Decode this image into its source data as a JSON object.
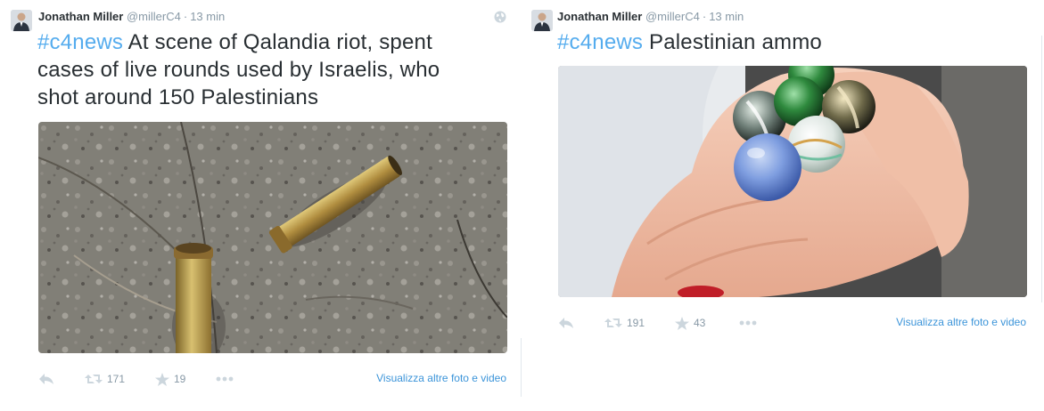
{
  "tweets": [
    {
      "author": {
        "name": "Jonathan Miller",
        "handle": "@millerC4"
      },
      "time": "13 min",
      "hashtag": "#c4news",
      "text_lines": [
        " At scene of Qalandia riot, spent",
        "cases of live rounds used by Israelis, who",
        "shot around 150 Palestinians"
      ],
      "icons": {
        "reply": "reply-icon",
        "retweet": "retweet-icon",
        "favorite": "star-icon",
        "more": "more-dots-icon",
        "globe": "globe-icon"
      },
      "retweets": "171",
      "favorites": "19",
      "more_link": "Visualizza altre foto e video"
    },
    {
      "author": {
        "name": "Jonathan Miller",
        "handle": "@millerC4"
      },
      "time": "13 min",
      "hashtag": "#c4news",
      "text_lines": [
        " Palestinian ammo"
      ],
      "icons": {
        "reply": "reply-icon",
        "retweet": "retweet-icon",
        "favorite": "star-icon",
        "more": "more-dots-icon"
      },
      "retweets": "191",
      "favorites": "43",
      "more_link": "Visualizza altre foto e video"
    }
  ],
  "colors": {
    "link": "#55acee",
    "muted": "#8899a6",
    "text": "#292f33",
    "more_link": "#3b94d9"
  }
}
